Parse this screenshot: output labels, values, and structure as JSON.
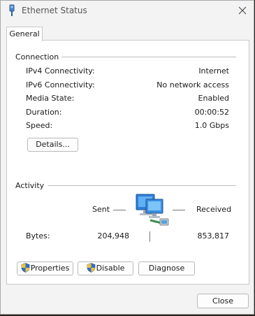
{
  "window": {
    "title": "Ethernet Status"
  },
  "tabs": [
    {
      "label": "General"
    }
  ],
  "connection": {
    "heading": "Connection",
    "rows": [
      {
        "label": "IPv4 Connectivity:",
        "value": "Internet"
      },
      {
        "label": "IPv6 Connectivity:",
        "value": "No network access"
      },
      {
        "label": "Media State:",
        "value": "Enabled"
      },
      {
        "label": "Duration:",
        "value": "00:00:52"
      },
      {
        "label": "Speed:",
        "value": "1.0 Gbps"
      }
    ],
    "details_label": "Details..."
  },
  "activity": {
    "heading": "Activity",
    "sent_label": "Sent",
    "received_label": "Received",
    "bytes_label": "Bytes:",
    "bytes_sent": "204,948",
    "bytes_received": "853,817"
  },
  "buttons": {
    "properties": "Properties",
    "disable": "Disable",
    "diagnose": "Diagnose",
    "close": "Close"
  },
  "icons": {
    "title": "ethernet-plug-icon",
    "window_close": "close-icon",
    "network": "network-computers-icon",
    "uac": "uac-shield-icon"
  }
}
